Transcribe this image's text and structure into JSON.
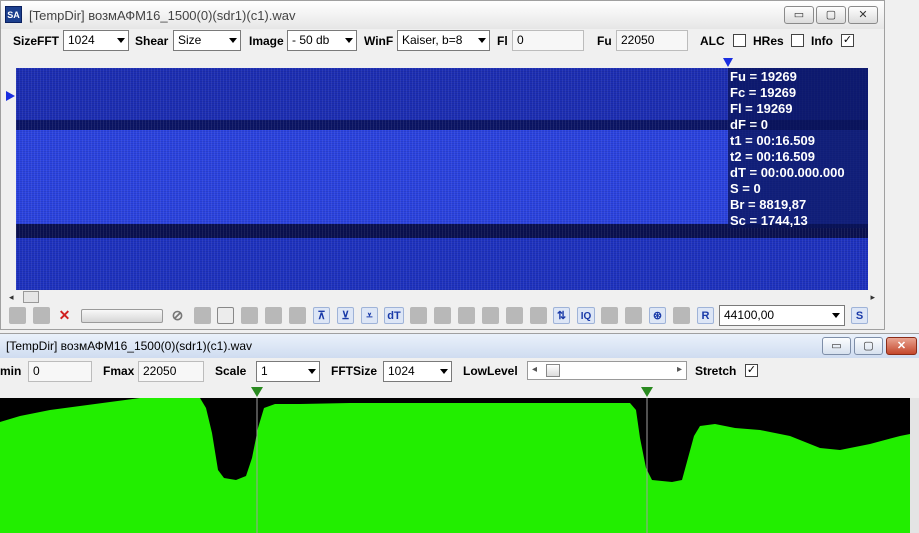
{
  "window1": {
    "app_icon": "SA",
    "title": "[TempDir] возмАФМ16_1500(0)(sdr1)(c1).wav",
    "buttons": {
      "minimize": "▭",
      "maximize": "▢",
      "close": "✕"
    },
    "controls": {
      "sizefft_label": "SizeFFT",
      "sizefft_value": "1024",
      "shear_label": "Shear",
      "shear_value": "Size",
      "image_label": "Image",
      "image_value": "- 50 db",
      "winf_label": "WinF",
      "winf_value": "Kaiser, b=8",
      "fl_label": "Fl",
      "fl_value": "0",
      "fu_label": "Fu",
      "fu_value": "22050",
      "alc_label": "ALC",
      "alc_checked": false,
      "hres_label": "HRes",
      "hres_checked": false,
      "info_label": "Info",
      "info_checked": true
    },
    "info": [
      "Fu = 19269",
      "Fc = 19269",
      "Fl = 19269",
      "dF = 0",
      "t1 = 00:16.509",
      "t2 = 00:16.509",
      "dT = 00:00.000.000",
      "S = 0",
      "Br = 8819,87",
      "Sc = 1744,13"
    ],
    "toolbar2": {
      "dt_label": "dT",
      "r_label": "R",
      "s_label": "S",
      "iq_label": "IQ",
      "samplerate_value": "44100,00"
    },
    "colors": {
      "spectrogram": "#2a3fcf",
      "info_text": "#ffffff"
    }
  },
  "window2": {
    "title": "[TempDir] возмАФМ16_1500(0)(sdr1)(c1).wav",
    "controls": {
      "fmin_label": "min",
      "fmin_value": "0",
      "fmax_label": "Fmax",
      "fmax_value": "22050",
      "scale_label": "Scale",
      "scale_value": "1",
      "fftsize_label": "FFTSize",
      "fftsize_value": "1024",
      "lowlevel_label": "LowLevel",
      "stretch_label": "Stretch",
      "stretch_checked": true
    },
    "colors": {
      "spectrum": "#22ee00",
      "background": "#000000",
      "cursor": "#2a8a20"
    }
  }
}
